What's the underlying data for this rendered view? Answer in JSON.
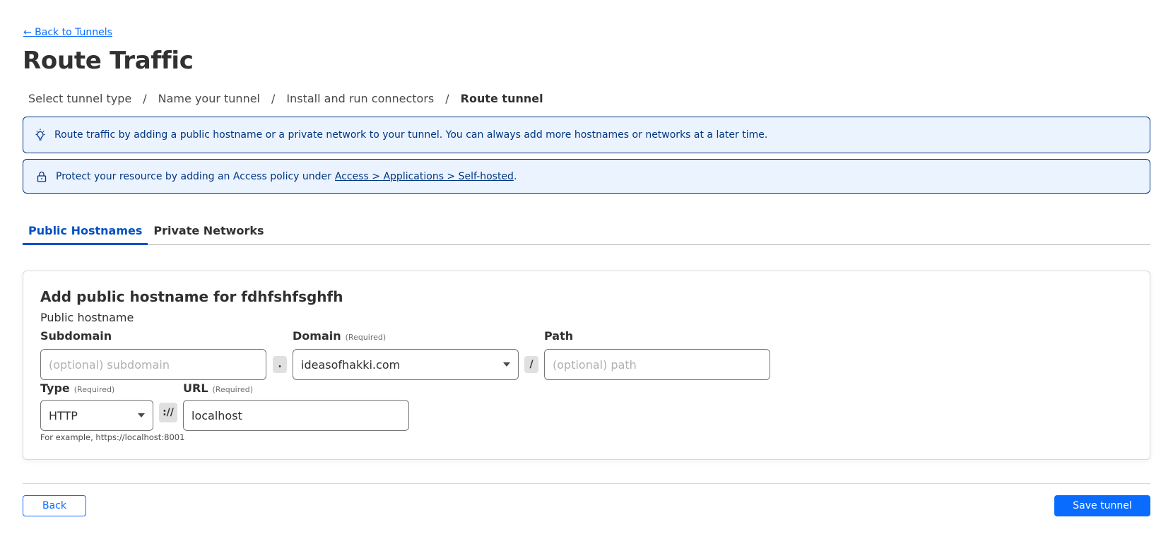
{
  "header": {
    "back_link": "← Back to Tunnels",
    "title": "Route Traffic"
  },
  "steps": [
    {
      "label": "Select tunnel type",
      "current": false
    },
    {
      "label": "Name your tunnel",
      "current": false
    },
    {
      "label": "Install and run connectors",
      "current": false
    },
    {
      "label": "Route tunnel",
      "current": true
    }
  ],
  "step_separator": "/",
  "banners": {
    "info": {
      "icon": "lightbulb-icon",
      "text": "Route traffic by adding a public hostname or a private network to your tunnel. You can always add more hostnames or networks at a later time."
    },
    "access": {
      "icon": "lock-icon",
      "text": "Protect your resource by adding an Access policy under",
      "link": "Access > Applications > Self-hosted",
      "suffix": "."
    }
  },
  "tabs": [
    {
      "label": "Public Hostnames",
      "active": true
    },
    {
      "label": "Private Networks",
      "active": false
    }
  ],
  "form": {
    "title": "Add public hostname for fdhfshfsghfh",
    "section_label": "Public hostname",
    "required_tag": "(Required)",
    "subdomain": {
      "label": "Subdomain",
      "value": "",
      "placeholder": "(optional) subdomain"
    },
    "dot_joiner": ".",
    "domain": {
      "label": "Domain",
      "value": "ideasofhakki.com"
    },
    "slash_joiner": "/",
    "path": {
      "label": "Path",
      "value": "",
      "placeholder": "(optional) path"
    },
    "type": {
      "label": "Type",
      "value": "HTTP"
    },
    "scheme_joiner": "://",
    "url": {
      "label": "URL",
      "value": "localhost",
      "placeholder": ""
    },
    "helper": "For example, https://localhost:8001"
  },
  "footer": {
    "back_label": "Back",
    "save_label": "Save tunnel"
  },
  "colors": {
    "primary": "#0a6cff",
    "tab_active": "#0051c3",
    "banner_bg": "#ebf3fe",
    "banner_border": "#003682"
  }
}
